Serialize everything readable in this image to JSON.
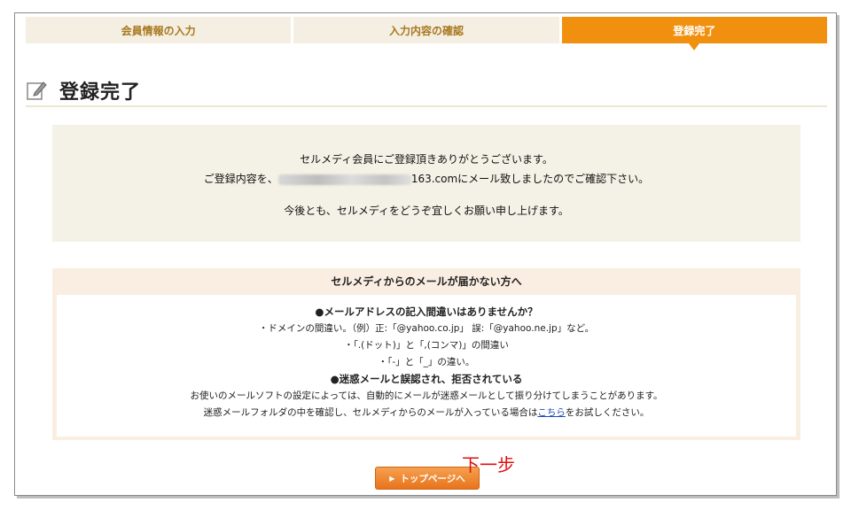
{
  "steps": [
    {
      "label": "会員情報の入力"
    },
    {
      "label": "入力内容の確認"
    },
    {
      "label": "登録完了"
    }
  ],
  "heading": {
    "title": "登録完了",
    "icon": "edit-note-icon"
  },
  "message": {
    "line1": "セルメディ会員にご登録頂きありがとうございます。",
    "line2_prefix": "ご登録内容を、",
    "line2_email_suffix": "163.com",
    "line2_rest": "にメール致しましたのでご確認下さい。",
    "line3": "今後とも、セルメディをどうぞ宜しくお願い申し上げます。"
  },
  "trouble": {
    "title": "セルメディからのメールが届かない方へ",
    "section1_heading": "●メールアドレスの記入間違いはありませんか？",
    "section1_line1": "・ドメインの間違い。（例）正:「@yahoo.co.jp」 誤:「@yahoo.ne.jp」など。",
    "section1_line2": "・「.(ドット)」と「,(コンマ)」の間違い",
    "section1_line3": "・「-」と「_」の違い。",
    "section2_heading": "●迷惑メールと誤認され、拒否されている",
    "section2_line1": "お使いのメールソフトの設定によっては、自動的にメールが迷惑メールとして振り分けてしまうことがあります。",
    "section2_line2_prefix": "迷惑メールフォルダの中を確認し、セルメディからのメールが入っている場合は",
    "section2_link": "こちら",
    "section2_line2_suffix": "をお試しください。"
  },
  "footer": {
    "top_button_label": "トップページへ",
    "annotation": "下一步"
  },
  "colors": {
    "accent": "#f0900e",
    "step_bg": "#f4efe2",
    "step_text": "#a8771d"
  }
}
